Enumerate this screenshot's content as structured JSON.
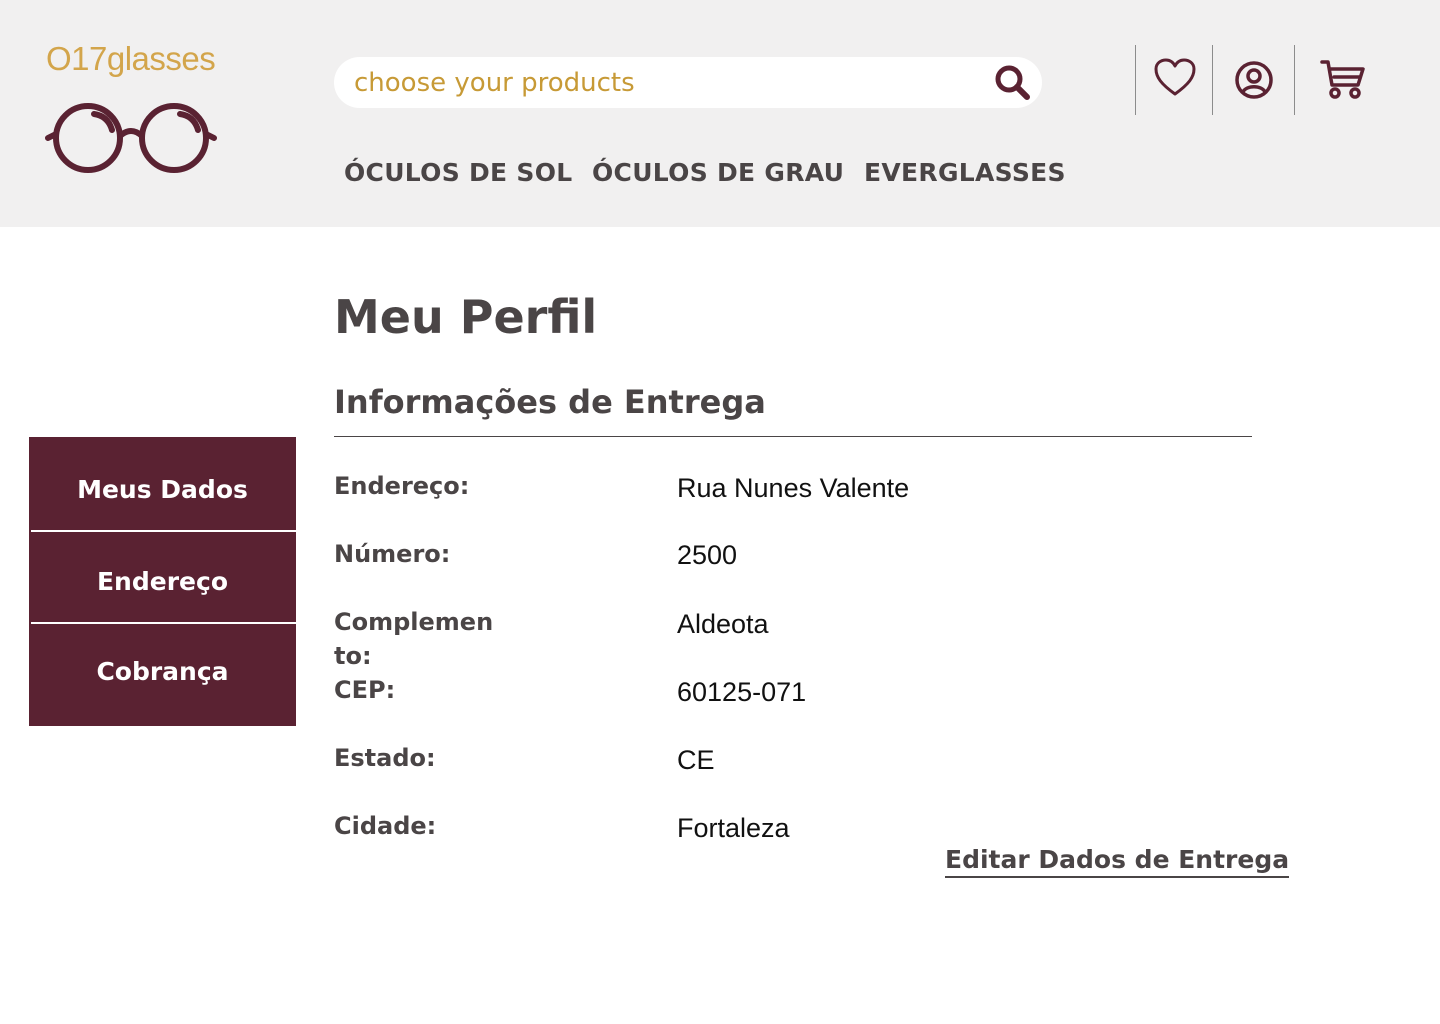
{
  "brand": {
    "logo_text": "O17glasses",
    "primary_color": "#5a2232",
    "gold_color": "#d3a54b"
  },
  "search": {
    "placeholder": "choose your products",
    "icon": "search-icon"
  },
  "header_icons": [
    {
      "name": "heart-icon"
    },
    {
      "name": "user-icon"
    },
    {
      "name": "cart-icon"
    }
  ],
  "nav": {
    "items": [
      "ÓCULOS DE SOL",
      "ÓCULOS DE GRAU",
      "EVERGLASSES"
    ]
  },
  "page": {
    "title": "Meu Perfil",
    "section_title": "Informações de Entrega"
  },
  "sidebar": {
    "items": [
      "Meus Dados",
      "Endereço",
      "Cobrança"
    ]
  },
  "fields": [
    {
      "label": "Endereço:",
      "value": "Rua Nunes Valente"
    },
    {
      "label": "Número:",
      "value": "2500"
    },
    {
      "label": "Complemento:",
      "value": "Aldeota"
    },
    {
      "label": "CEP:",
      "value": "60125-071"
    },
    {
      "label": "Estado:",
      "value": "CE"
    },
    {
      "label": "Cidade:",
      "value": "Fortaleza"
    }
  ],
  "actions": {
    "edit_label": "Editar Dados de Entrega"
  }
}
